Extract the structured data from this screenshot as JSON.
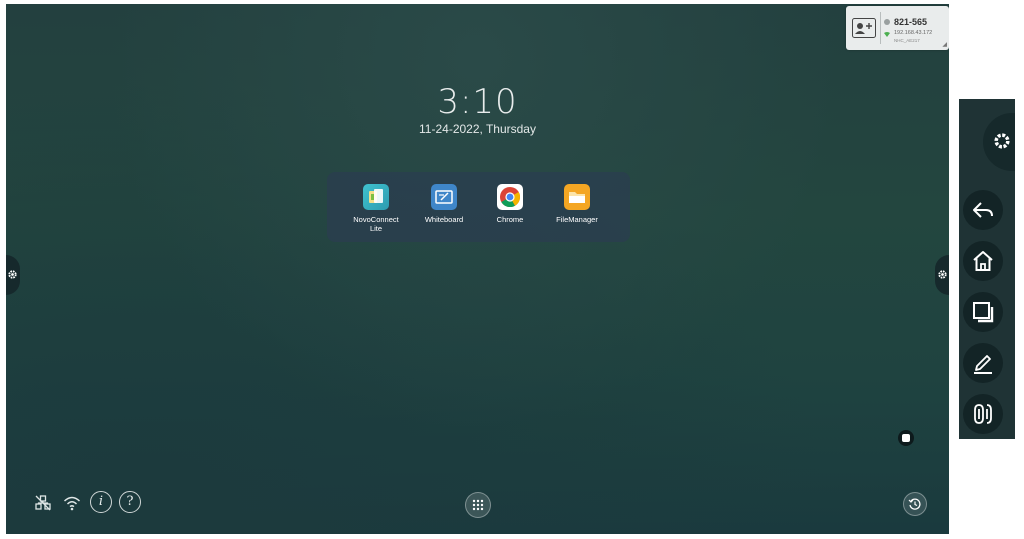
{
  "clock": {
    "time": "3:10",
    "date": "11-24-2022, Thursday"
  },
  "apps": [
    {
      "label": "NovoConnect\nLite",
      "icon": "novoconnect-icon"
    },
    {
      "label": "Whiteboard",
      "icon": "whiteboard-icon"
    },
    {
      "label": "Chrome",
      "icon": "chrome-icon"
    },
    {
      "label": "FileManager",
      "icon": "folder-icon"
    }
  ],
  "info_card": {
    "code": "821-565",
    "ip": "192.168.43.172",
    "ssid": "NHC_AE217"
  },
  "bottom_bar": {
    "left_icons": [
      "network-disconnected-icon",
      "wifi-icon",
      "info-icon",
      "help-icon"
    ],
    "info_glyph": "i",
    "help_glyph": "?",
    "center_icon": "app-grid-icon",
    "right_icon": "history-icon"
  },
  "side_panel": {
    "buttons": [
      "settings-icon",
      "back-icon",
      "home-icon",
      "recent-apps-icon",
      "annotate-icon",
      "toolbox-icon"
    ]
  },
  "colors": {
    "background": "#23443f",
    "dock": "#2a3e50",
    "side_panel": "#1f3335",
    "accent_fm": "#f4a623",
    "accent_wb": "#3f86c9"
  }
}
